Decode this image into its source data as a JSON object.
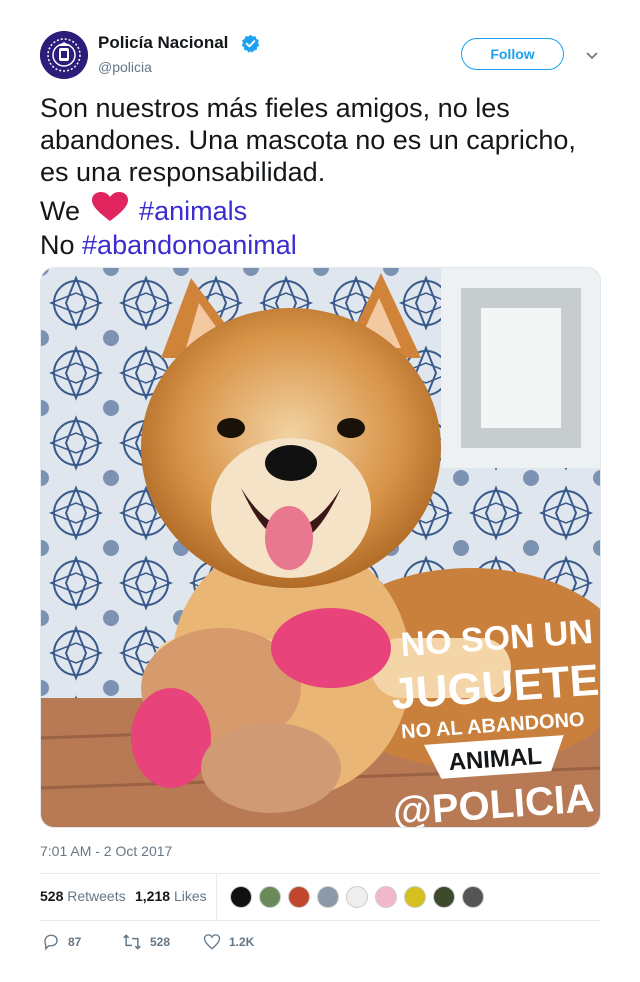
{
  "user": {
    "display_name": "Policía Nacional",
    "handle": "@policia",
    "verified": true
  },
  "follow_label": "Follow",
  "tweet": {
    "line1": "Son nuestros más fieles amigos, no les",
    "line2": "abandones. Una mascota no es un capricho,",
    "line3": "es una responsabilidad.",
    "we": "We",
    "hashtag_animals": "#animals",
    "no": "No",
    "hashtag_abandono": "#abandonoanimal"
  },
  "photo": {
    "overlay_line1": "NO SON UN",
    "overlay_line2": "JUGUETE",
    "overlay_line3": "NO AL ABANDONO",
    "overlay_line4": "ANIMAL",
    "overlay_line5": "@POLICIA"
  },
  "timestamp": "7:01 AM - 2 Oct 2017",
  "stats": {
    "retweets_count": "528",
    "retweets_label": "Retweets",
    "likes_count": "1,218",
    "likes_label": "Likes"
  },
  "actions": {
    "reply_count": "87",
    "retweet_count": "528",
    "like_count": "1.2K"
  },
  "colors": {
    "link": "#3b2ccf",
    "accent": "#1da1f2",
    "verified": "#1da1f2",
    "heart": "#e0245e"
  },
  "icons": [
    "verified-badge-icon",
    "chevron-down-icon",
    "heart-emoji-icon",
    "reply-icon",
    "retweet-icon",
    "like-icon"
  ]
}
